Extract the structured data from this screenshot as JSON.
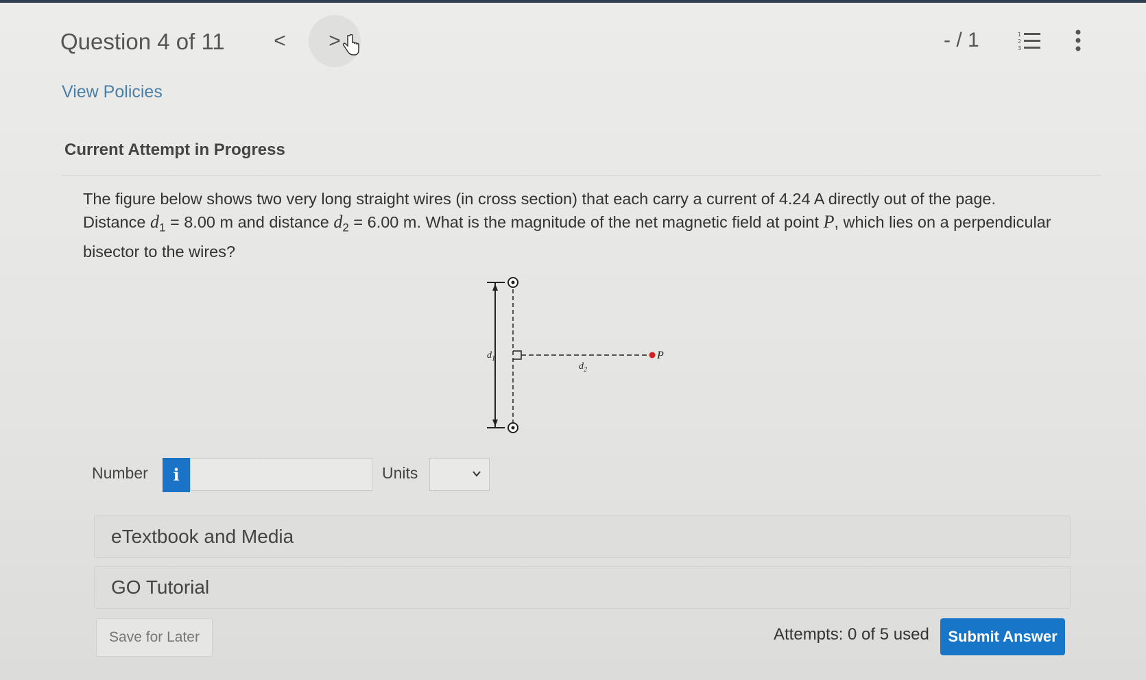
{
  "header": {
    "question_counter": "Question 4 of 11",
    "prev_glyph": "<",
    "next_glyph": ">",
    "score": "- / 1"
  },
  "links": {
    "view_policies": "View Policies"
  },
  "attempt": {
    "heading": "Current Attempt in Progress"
  },
  "question": {
    "line1": "The figure below shows two very long straight wires (in cross section) that each carry a current of 4.24 A directly out of the page.",
    "l2_a": "Distance ",
    "d_symbol": "d",
    "sub1": "1",
    "l2_b": " = 8.00 m and distance ",
    "sub2": "2",
    "l2_c": " = 6.00 m. What is the magnitude of the net magnetic field at point ",
    "p_symbol": "P",
    "l2_d": ", which lies on a perpendicular",
    "line3": "bisector to the wires?"
  },
  "figure": {
    "label_d1": "d",
    "label_d1_sub": "1",
    "label_d2": "d",
    "label_d2_sub": "2",
    "label_p": "P",
    "point_color": "#d42020"
  },
  "answer": {
    "number_label": "Number",
    "info_glyph": "i",
    "number_value": "",
    "units_label": "Units",
    "units_selected": ""
  },
  "panels": {
    "etextbook": "eTextbook and Media",
    "go_tutorial": "GO Tutorial"
  },
  "footer": {
    "save_later": "Save for Later",
    "attempts": "Attempts: 0 of 5 used",
    "submit": "Submit Answer"
  },
  "colors": {
    "accent": "#1876c8",
    "link": "#4a7fa8"
  },
  "icons": [
    "chevron-left-icon",
    "chevron-right-icon",
    "hand-cursor-icon",
    "numbered-list-icon",
    "kebab-menu-icon",
    "info-icon",
    "chevron-down-icon"
  ]
}
